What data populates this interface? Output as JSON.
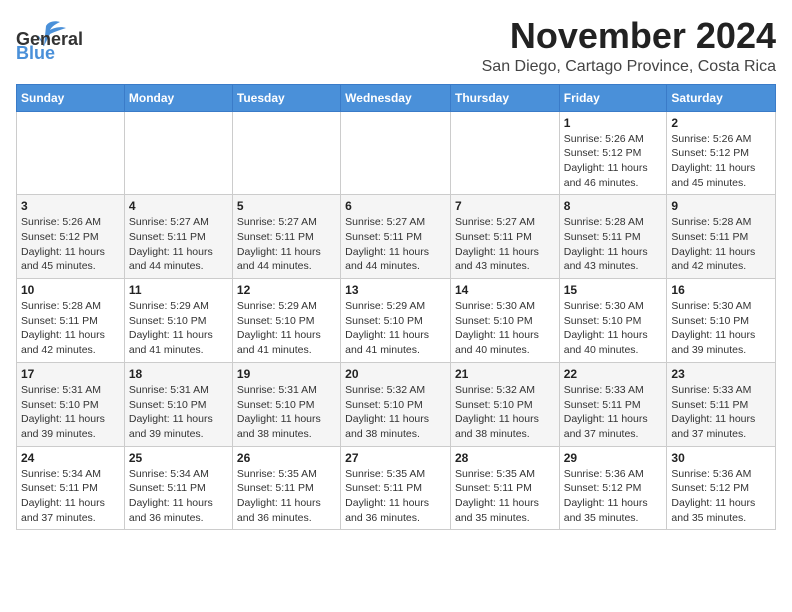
{
  "header": {
    "logo_general": "General",
    "logo_blue": "Blue",
    "month_title": "November 2024",
    "subtitle": "San Diego, Cartago Province, Costa Rica"
  },
  "weekdays": [
    "Sunday",
    "Monday",
    "Tuesday",
    "Wednesday",
    "Thursday",
    "Friday",
    "Saturday"
  ],
  "weeks": [
    [
      {
        "day": "",
        "info": ""
      },
      {
        "day": "",
        "info": ""
      },
      {
        "day": "",
        "info": ""
      },
      {
        "day": "",
        "info": ""
      },
      {
        "day": "",
        "info": ""
      },
      {
        "day": "1",
        "info": "Sunrise: 5:26 AM\nSunset: 5:12 PM\nDaylight: 11 hours\nand 46 minutes."
      },
      {
        "day": "2",
        "info": "Sunrise: 5:26 AM\nSunset: 5:12 PM\nDaylight: 11 hours\nand 45 minutes."
      }
    ],
    [
      {
        "day": "3",
        "info": "Sunrise: 5:26 AM\nSunset: 5:12 PM\nDaylight: 11 hours\nand 45 minutes."
      },
      {
        "day": "4",
        "info": "Sunrise: 5:27 AM\nSunset: 5:11 PM\nDaylight: 11 hours\nand 44 minutes."
      },
      {
        "day": "5",
        "info": "Sunrise: 5:27 AM\nSunset: 5:11 PM\nDaylight: 11 hours\nand 44 minutes."
      },
      {
        "day": "6",
        "info": "Sunrise: 5:27 AM\nSunset: 5:11 PM\nDaylight: 11 hours\nand 44 minutes."
      },
      {
        "day": "7",
        "info": "Sunrise: 5:27 AM\nSunset: 5:11 PM\nDaylight: 11 hours\nand 43 minutes."
      },
      {
        "day": "8",
        "info": "Sunrise: 5:28 AM\nSunset: 5:11 PM\nDaylight: 11 hours\nand 43 minutes."
      },
      {
        "day": "9",
        "info": "Sunrise: 5:28 AM\nSunset: 5:11 PM\nDaylight: 11 hours\nand 42 minutes."
      }
    ],
    [
      {
        "day": "10",
        "info": "Sunrise: 5:28 AM\nSunset: 5:11 PM\nDaylight: 11 hours\nand 42 minutes."
      },
      {
        "day": "11",
        "info": "Sunrise: 5:29 AM\nSunset: 5:10 PM\nDaylight: 11 hours\nand 41 minutes."
      },
      {
        "day": "12",
        "info": "Sunrise: 5:29 AM\nSunset: 5:10 PM\nDaylight: 11 hours\nand 41 minutes."
      },
      {
        "day": "13",
        "info": "Sunrise: 5:29 AM\nSunset: 5:10 PM\nDaylight: 11 hours\nand 41 minutes."
      },
      {
        "day": "14",
        "info": "Sunrise: 5:30 AM\nSunset: 5:10 PM\nDaylight: 11 hours\nand 40 minutes."
      },
      {
        "day": "15",
        "info": "Sunrise: 5:30 AM\nSunset: 5:10 PM\nDaylight: 11 hours\nand 40 minutes."
      },
      {
        "day": "16",
        "info": "Sunrise: 5:30 AM\nSunset: 5:10 PM\nDaylight: 11 hours\nand 39 minutes."
      }
    ],
    [
      {
        "day": "17",
        "info": "Sunrise: 5:31 AM\nSunset: 5:10 PM\nDaylight: 11 hours\nand 39 minutes."
      },
      {
        "day": "18",
        "info": "Sunrise: 5:31 AM\nSunset: 5:10 PM\nDaylight: 11 hours\nand 39 minutes."
      },
      {
        "day": "19",
        "info": "Sunrise: 5:31 AM\nSunset: 5:10 PM\nDaylight: 11 hours\nand 38 minutes."
      },
      {
        "day": "20",
        "info": "Sunrise: 5:32 AM\nSunset: 5:10 PM\nDaylight: 11 hours\nand 38 minutes."
      },
      {
        "day": "21",
        "info": "Sunrise: 5:32 AM\nSunset: 5:10 PM\nDaylight: 11 hours\nand 38 minutes."
      },
      {
        "day": "22",
        "info": "Sunrise: 5:33 AM\nSunset: 5:11 PM\nDaylight: 11 hours\nand 37 minutes."
      },
      {
        "day": "23",
        "info": "Sunrise: 5:33 AM\nSunset: 5:11 PM\nDaylight: 11 hours\nand 37 minutes."
      }
    ],
    [
      {
        "day": "24",
        "info": "Sunrise: 5:34 AM\nSunset: 5:11 PM\nDaylight: 11 hours\nand 37 minutes."
      },
      {
        "day": "25",
        "info": "Sunrise: 5:34 AM\nSunset: 5:11 PM\nDaylight: 11 hours\nand 36 minutes."
      },
      {
        "day": "26",
        "info": "Sunrise: 5:35 AM\nSunset: 5:11 PM\nDaylight: 11 hours\nand 36 minutes."
      },
      {
        "day": "27",
        "info": "Sunrise: 5:35 AM\nSunset: 5:11 PM\nDaylight: 11 hours\nand 36 minutes."
      },
      {
        "day": "28",
        "info": "Sunrise: 5:35 AM\nSunset: 5:11 PM\nDaylight: 11 hours\nand 35 minutes."
      },
      {
        "day": "29",
        "info": "Sunrise: 5:36 AM\nSunset: 5:12 PM\nDaylight: 11 hours\nand 35 minutes."
      },
      {
        "day": "30",
        "info": "Sunrise: 5:36 AM\nSunset: 5:12 PM\nDaylight: 11 hours\nand 35 minutes."
      }
    ]
  ]
}
